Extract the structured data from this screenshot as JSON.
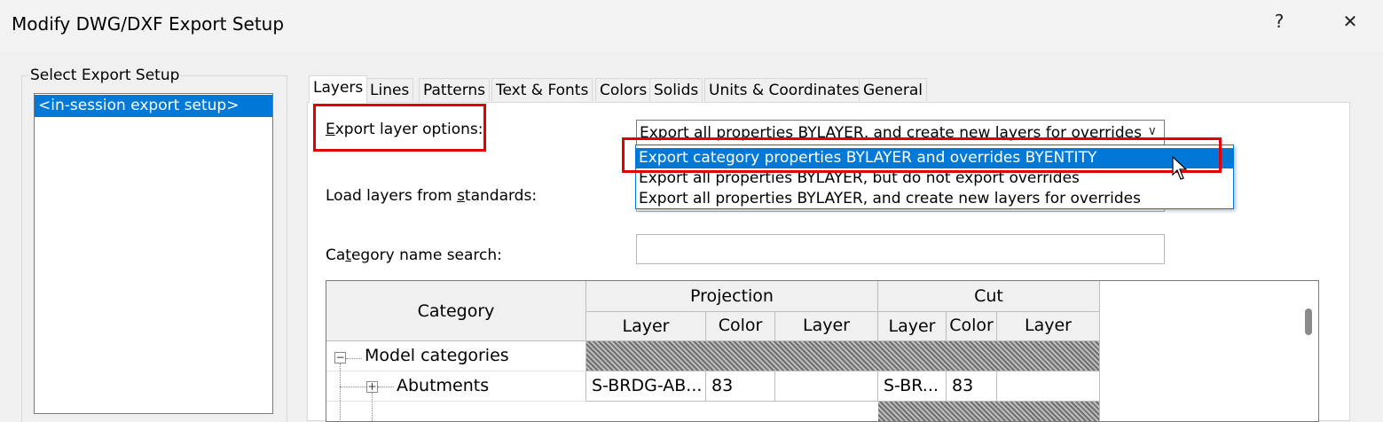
{
  "window": {
    "title": "Modify DWG/DXF Export Setup",
    "help": "?",
    "close": "✕"
  },
  "setup_panel": {
    "label": "Select Export Setup",
    "items": [
      "<in-session export setup>"
    ]
  },
  "tabs": [
    "Layers",
    "Lines",
    "Patterns",
    "Text & Fonts",
    "Colors",
    "Solids",
    "Units & Coordinates",
    "General"
  ],
  "active_tab": "Layers",
  "layers": {
    "export_options_label_first": "E",
    "export_options_label_rest": "xport layer options:",
    "export_options_value": "Export all properties BYLAYER, and create new layers for overrides",
    "dropdown_options": [
      "Export category properties BYLAYER and overrides BYENTITY",
      "Export all properties BYLAYER, but do not export overrides",
      "Export all properties BYLAYER, and create new layers for overrides"
    ],
    "highlighted_option_index": 0,
    "load_layers_pre": "Load layers from ",
    "load_layers_u": "s",
    "load_layers_post": "tandards:",
    "category_search_pre": "Ca",
    "category_search_u": "t",
    "category_search_post": "egory name search:",
    "category_search_value": ""
  },
  "table": {
    "headers": {
      "category": "Category",
      "projection": "Projection",
      "cut": "Cut",
      "proj_layer": "Layer",
      "proj_color": "Color",
      "proj_layer2": "Layer",
      "cut_layer": "Layer",
      "cut_color": "Color",
      "cut_layer2": "Layer"
    },
    "rows": [
      {
        "category": "Model categories",
        "expander": "−"
      },
      {
        "category": "Abutments",
        "expander": "+",
        "proj_layer": "S-BRDG-AB...",
        "proj_color": "83",
        "proj_layer2": "",
        "cut_layer": "S-BR...",
        "cut_color": "83",
        "cut_layer2": ""
      }
    ]
  }
}
